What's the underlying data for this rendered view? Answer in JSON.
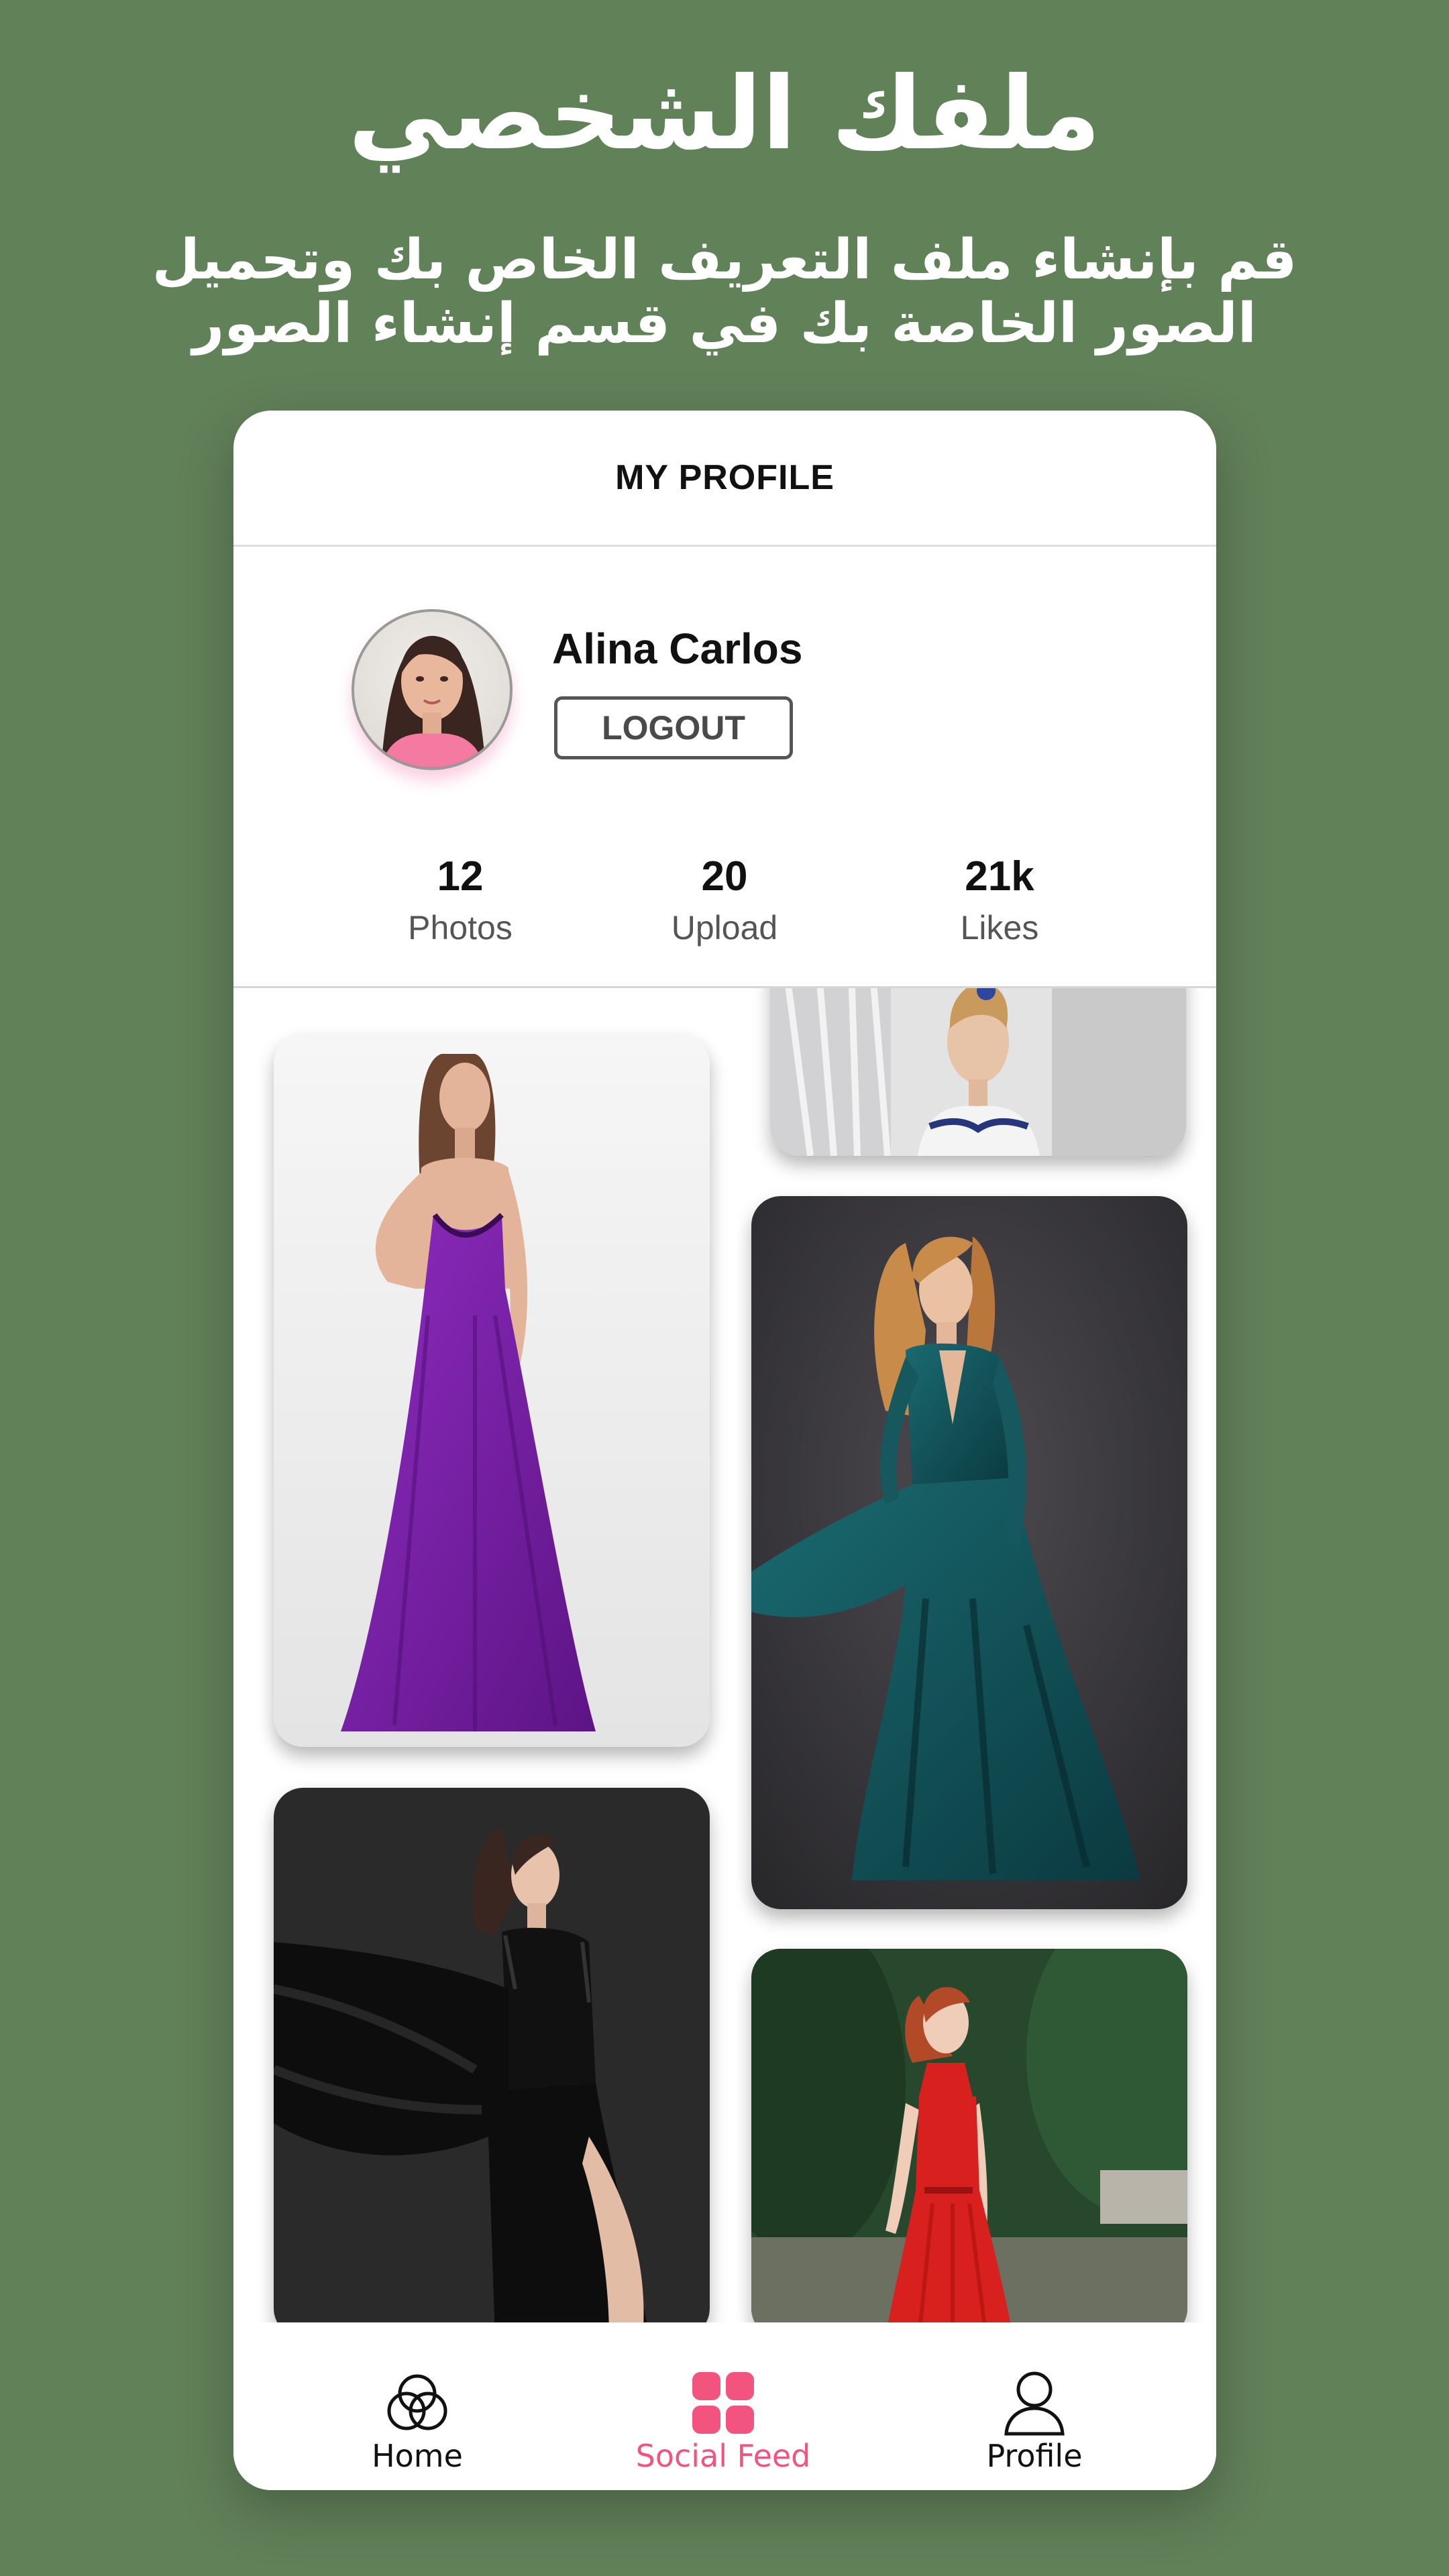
{
  "promo": {
    "title": "ملفك الشخصي",
    "subtitle": "قم بإنشاء ملف التعريف الخاص بك وتحميل الصور الخاصة بك في قسم إنشاء الصور"
  },
  "header": {
    "title": "MY PROFILE"
  },
  "profile": {
    "name": "Alina Carlos",
    "logout_label": "LOGOUT"
  },
  "stats": [
    {
      "value": "12",
      "label": "Photos"
    },
    {
      "value": "20",
      "label": "Upload"
    },
    {
      "value": "21k",
      "label": "Likes"
    }
  ],
  "gallery": {
    "photos": [
      {
        "subject": "woman in white strapless gown with blue embroidery",
        "dress_color": "#f4f4f4",
        "background": "#e3e3e3"
      },
      {
        "subject": "woman in long purple dress",
        "dress_color": "#7a1ea6",
        "background": "#efefef"
      },
      {
        "subject": "woman in flowing teal satin gown",
        "dress_color": "#0f4a50",
        "background": "#3c3a3e"
      },
      {
        "subject": "woman in black lace gown with flowing fabric",
        "dress_color": "#111111",
        "background": "#2b2b2b"
      },
      {
        "subject": "woman in red halter dress in garden",
        "dress_color": "#d8201e",
        "background": "#2c5231"
      }
    ]
  },
  "tabbar": {
    "items": [
      {
        "label": "Home",
        "icon": "home-circles-icon",
        "active": false
      },
      {
        "label": "Social Feed",
        "icon": "grid-icon",
        "active": true
      },
      {
        "label": "Profile",
        "icon": "person-icon",
        "active": false
      }
    ]
  },
  "colors": {
    "background": "#618159",
    "accent": "#f3537f",
    "text": "#111111"
  }
}
